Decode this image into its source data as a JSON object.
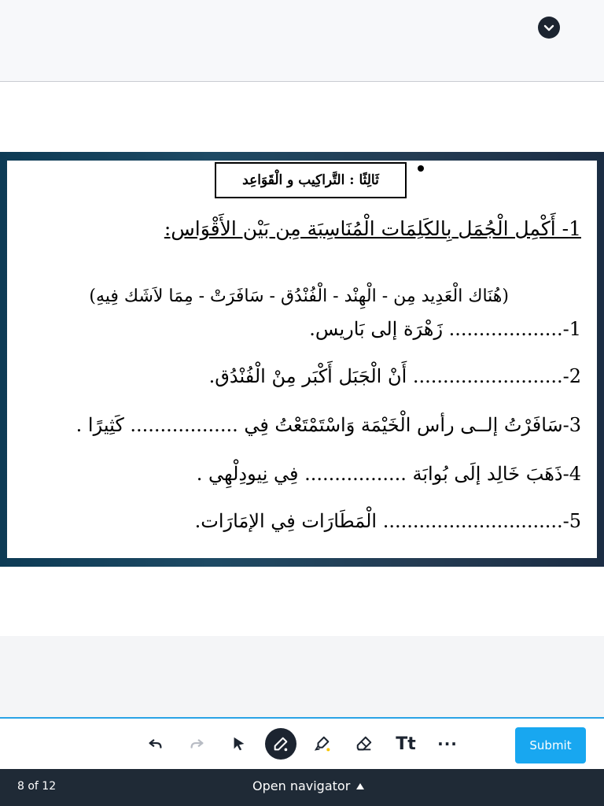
{
  "header": {
    "collapse_icon": "chevron-down-icon"
  },
  "worksheet": {
    "section_title": "ثَالِثًا : التَّراكِيب و الْقَوَاعِد",
    "instruction": "1- أَكْمِل الْجُمَل بِالكَلِمَات الْمُنَاسِبَة مِن بَيْن الأَقْوَاس:",
    "word_bank": "(هُنَاك الْعَدِيد مِن - الْهِنْد - الْفُنْدُق - سَافَرَتْ - مِمَا لاَشَك فِيهِ)",
    "questions": [
      "1-................... زَهْرَة إلى بَاريس.",
      "2-......................... أَنْ الْجَبَل أَكْبَر مِنْ الْفُنْدُق.",
      "3-سَافَرْتُ إلــى رأس الْخَيْمَة وَاسْتَمْتَعْتُ فِي .................. كَثِيرًا .",
      "4-ذَهَبَ خَالِد إلَى بُوابَة ................. فِي نِيودِلْهِي .",
      "5-.............................. الْمَطَارَات فِي الإمَارَات."
    ]
  },
  "toolbar": {
    "tools": [
      {
        "name": "undo",
        "icon": "undo-icon",
        "enabled": true
      },
      {
        "name": "redo",
        "icon": "redo-icon",
        "enabled": false
      },
      {
        "name": "select",
        "icon": "pointer-icon",
        "enabled": true
      },
      {
        "name": "pen",
        "icon": "pen-icon",
        "enabled": true,
        "active": true
      },
      {
        "name": "highlighter",
        "icon": "highlighter-icon",
        "enabled": true
      },
      {
        "name": "eraser",
        "icon": "eraser-icon",
        "enabled": true
      }
    ],
    "text_tool_label": "Tt",
    "more_label": "···",
    "submit_label": "Submit",
    "accent_color": "#18a7f0",
    "highlighter_dot_color": "#f5c400"
  },
  "footer": {
    "page_counter": "8 of 12",
    "navigator_label": "Open navigator"
  }
}
